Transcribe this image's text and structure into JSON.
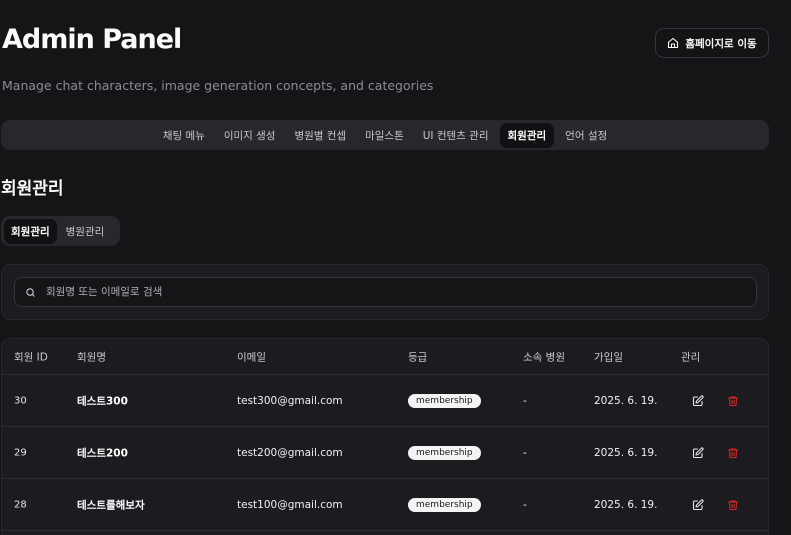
{
  "header": {
    "title": "Admin Panel",
    "subtitle": "Manage chat characters, image generation concepts, and categories",
    "home_button": "홈페이지로 이동"
  },
  "nav": {
    "items": [
      "채팅 메뉴",
      "이미지 생성",
      "병원별 컨셉",
      "마일스톤",
      "UI 컨텐츠 관리",
      "회원관리",
      "언어 설정"
    ],
    "active": "회원관리"
  },
  "section": {
    "title": "회원관리",
    "tabs": [
      "회원관리",
      "병원관리"
    ],
    "active_tab": "회원관리"
  },
  "search": {
    "placeholder": "회원명 또는 이메일로 검색",
    "value": ""
  },
  "table": {
    "columns": [
      "회원 ID",
      "회원명",
      "이메일",
      "등급",
      "소속 병원",
      "가입일",
      "관리"
    ],
    "rows": [
      {
        "id": "30",
        "name": "테스트300",
        "email": "test300@gmail.com",
        "grade": "membership",
        "hospital": "-",
        "joined": "2025. 6. 19."
      },
      {
        "id": "29",
        "name": "테스트200",
        "email": "test200@gmail.com",
        "grade": "membership",
        "hospital": "-",
        "joined": "2025. 6. 19."
      },
      {
        "id": "28",
        "name": "테스트를해보자",
        "email": "test100@gmail.com",
        "grade": "membership",
        "hospital": "-",
        "joined": "2025. 6. 19."
      }
    ]
  },
  "icons": {
    "home": "home-icon",
    "search": "search-icon",
    "edit": "edit-icon",
    "delete": "trash-icon"
  },
  "colors": {
    "background": "#151518",
    "delete": "#dc2626",
    "badge_bg": "#f4f4f5"
  }
}
